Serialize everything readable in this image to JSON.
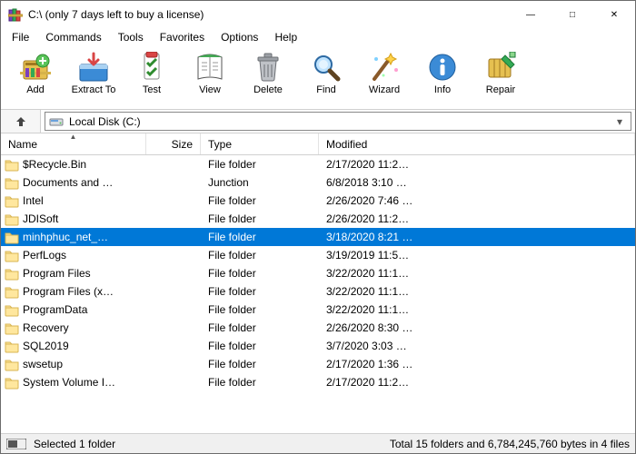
{
  "window": {
    "title": "C:\\ (only 7 days left to buy a license)"
  },
  "menu": [
    "File",
    "Commands",
    "Tools",
    "Favorites",
    "Options",
    "Help"
  ],
  "toolbar": [
    {
      "id": "add",
      "label": "Add"
    },
    {
      "id": "extract",
      "label": "Extract To"
    },
    {
      "id": "test",
      "label": "Test"
    },
    {
      "id": "view",
      "label": "View"
    },
    {
      "id": "delete",
      "label": "Delete"
    },
    {
      "id": "find",
      "label": "Find"
    },
    {
      "id": "wizard",
      "label": "Wizard"
    },
    {
      "id": "info",
      "label": "Info"
    },
    {
      "id": "repair",
      "label": "Repair"
    }
  ],
  "address": {
    "label": "Local Disk (C:)"
  },
  "columns": {
    "name": "Name",
    "size": "Size",
    "type": "Type",
    "modified": "Modified"
  },
  "files": [
    {
      "name": "$Recycle.Bin",
      "type": "File folder",
      "mod": "2/17/2020 11:2…",
      "sel": false
    },
    {
      "name": "Documents and …",
      "type": "Junction",
      "mod": "6/8/2018 3:10 …",
      "sel": false
    },
    {
      "name": "Intel",
      "type": "File folder",
      "mod": "2/26/2020 7:46 …",
      "sel": false
    },
    {
      "name": "JDISoft",
      "type": "File folder",
      "mod": "2/26/2020 11:2…",
      "sel": false
    },
    {
      "name": "minhphuc_net_…",
      "type": "File folder",
      "mod": "3/18/2020 8:21 …",
      "sel": true
    },
    {
      "name": "PerfLogs",
      "type": "File folder",
      "mod": "3/19/2019 11:5…",
      "sel": false
    },
    {
      "name": "Program Files",
      "type": "File folder",
      "mod": "3/22/2020 11:1…",
      "sel": false
    },
    {
      "name": "Program Files (x…",
      "type": "File folder",
      "mod": "3/22/2020 11:1…",
      "sel": false
    },
    {
      "name": "ProgramData",
      "type": "File folder",
      "mod": "3/22/2020 11:1…",
      "sel": false
    },
    {
      "name": "Recovery",
      "type": "File folder",
      "mod": "2/26/2020 8:30 …",
      "sel": false
    },
    {
      "name": "SQL2019",
      "type": "File folder",
      "mod": "3/7/2020 3:03 …",
      "sel": false
    },
    {
      "name": "swsetup",
      "type": "File folder",
      "mod": "2/17/2020 1:36 …",
      "sel": false
    },
    {
      "name": "System Volume I…",
      "type": "File folder",
      "mod": "2/17/2020 11:2…",
      "sel": false
    }
  ],
  "status": {
    "left": "Selected 1 folder",
    "right": "Total 15 folders and 6,784,245,760 bytes in 4 files"
  }
}
